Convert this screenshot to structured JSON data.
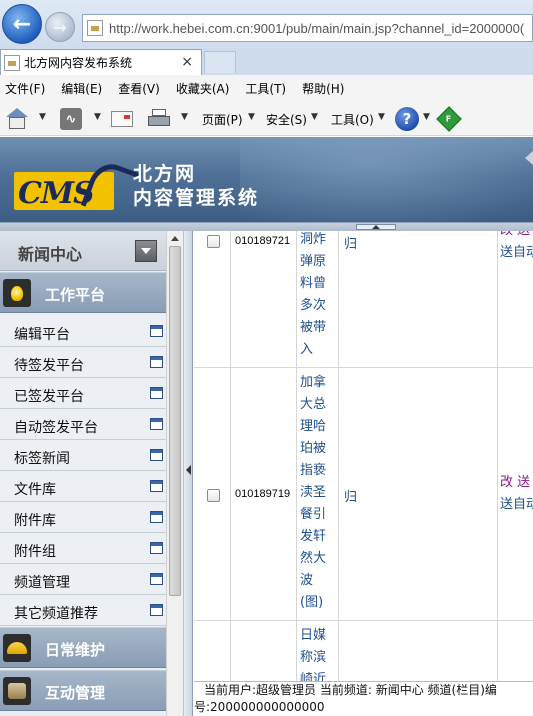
{
  "browser": {
    "url": "http://work.hebei.com.cn:9001/pub/main/main.jsp?channel_id=2000000(",
    "tab_title": "北方网内容发布系统",
    "tab_close": "×",
    "menu": [
      "文件(F)",
      "编辑(E)",
      "查看(V)",
      "收藏夹(A)",
      "工具(T)",
      "帮助(H)"
    ],
    "commands": {
      "page": "页面(P)",
      "safety": "安全(S)",
      "tools": "工具(O)",
      "help_glyph": "?",
      "fav_glyph": "F"
    }
  },
  "header": {
    "logo_text": "CMS",
    "brand_line1": "北方网",
    "brand_line2": "内容管理系统"
  },
  "sidebar": {
    "title": "新闻中心",
    "groups": [
      {
        "label": "工作平台",
        "icon": "lightbulb-icon",
        "items": [
          "编辑平台",
          "待签发平台",
          "已签发平台",
          "自动签发平台",
          "标签新闻",
          "文件库",
          "附件库",
          "附件组",
          "频道管理",
          "其它频道推荐"
        ]
      },
      {
        "label": "日常维护",
        "icon": "helmet-icon"
      },
      {
        "label": "互动管理",
        "icon": "interaction-icon"
      }
    ]
  },
  "table": {
    "rows": [
      {
        "id": "010189721",
        "title_chars": [
          "洞炸",
          "弹原",
          "料曾",
          "多次",
          "被带",
          "入"
        ],
        "col3": "归",
        "ops": [
          "改 送",
          "送自动"
        ]
      },
      {
        "id": "010189719",
        "title_chars": [
          "加拿",
          "大总",
          "理哈",
          "珀被",
          "指亵",
          "渎圣",
          "餐引",
          "发轩",
          "然大",
          "波",
          "(图)"
        ],
        "col3": "归",
        "ops": [
          "改 送",
          "送自动"
        ]
      },
      {
        "id": "",
        "title_chars": [
          "日媒",
          "称滨",
          "崎近"
        ],
        "col3": "",
        "ops": []
      }
    ]
  },
  "status": {
    "line1": "当前用户:超级管理员 当前频道: 新闻中心 频道(栏目)编",
    "line2": "号:200000000000000"
  }
}
